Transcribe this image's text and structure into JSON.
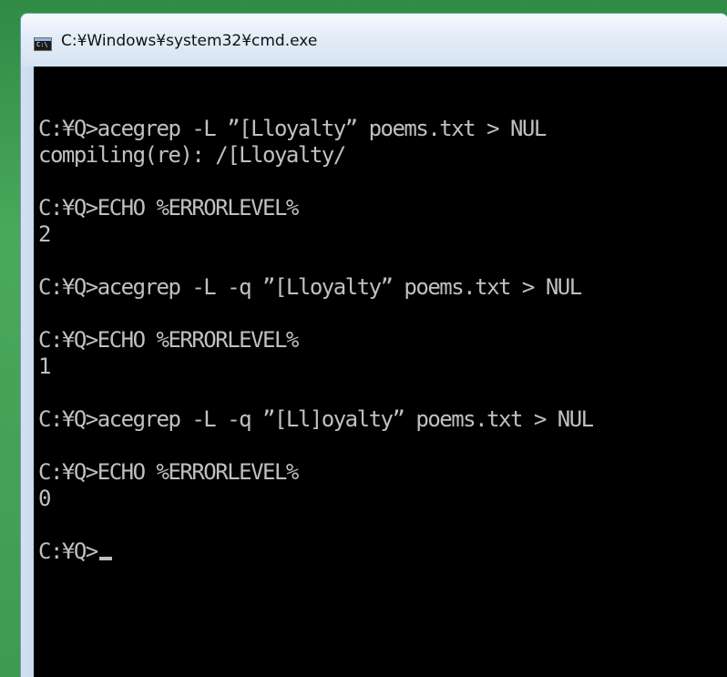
{
  "window": {
    "title": "C:¥Windows¥system32¥cmd.exe",
    "icon_label": "C:\\"
  },
  "console": {
    "lines": [
      "",
      "C:¥Q>acegrep -L ”[Lloyalty” poems.txt > NUL",
      "compiling(re): /[Lloyalty/",
      "",
      "C:¥Q>ECHO %ERRORLEVEL%",
      "2",
      "",
      "C:¥Q>acegrep -L -q ”[Lloyalty” poems.txt > NUL",
      "",
      "C:¥Q>ECHO %ERRORLEVEL%",
      "1",
      "",
      "C:¥Q>acegrep -L -q ”[Ll]oyalty” poems.txt > NUL",
      "",
      "C:¥Q>ECHO %ERRORLEVEL%",
      "0",
      "",
      "C:¥Q>"
    ]
  },
  "colors": {
    "console_bg": "#000000",
    "console_fg": "#c0c0c0",
    "desktop": "#3f9a52",
    "titlebar": "#dbe8f6"
  }
}
